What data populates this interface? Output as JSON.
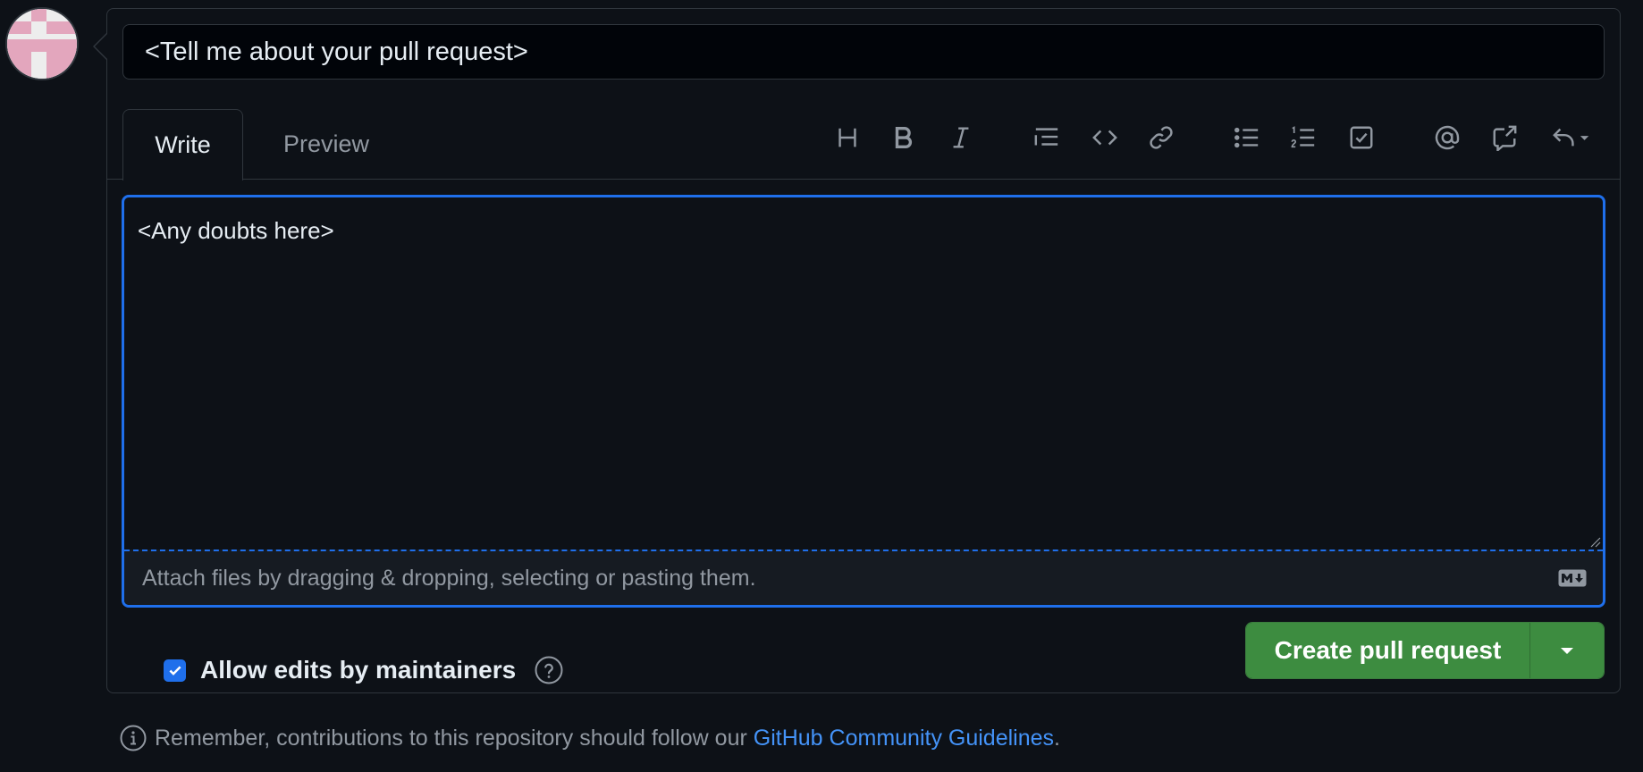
{
  "title_input": {
    "value": "<Tell me about your pull request>"
  },
  "tabs": [
    {
      "label": "Write",
      "active": true
    },
    {
      "label": "Preview",
      "active": false
    }
  ],
  "toolbar": {
    "icons": [
      "heading-icon",
      "bold-icon",
      "italic-icon",
      "quote-icon",
      "code-icon",
      "link-icon",
      "unordered-list-icon",
      "ordered-list-icon",
      "task-list-icon",
      "mention-icon",
      "cross-reference-icon",
      "saved-replies-icon"
    ]
  },
  "editor": {
    "value": "<Any doubts here>",
    "attach_text": "Attach files by dragging & dropping, selecting or pasting them."
  },
  "options": {
    "allow_edits_label": "Allow edits by maintainers",
    "allow_edits_checked": true
  },
  "actions": {
    "create_label": "Create pull request"
  },
  "footer": {
    "prefix": "Remember, contributions to this repository should follow our",
    "link_text": "GitHub Community Guidelines",
    "suffix": "."
  },
  "colors": {
    "background": "#0d1117",
    "border": "#30363d",
    "accent_blue": "#1f6feb",
    "primary_green": "#3d8c40",
    "link": "#4493f8",
    "avatar_pink": "#e3a6bd"
  }
}
